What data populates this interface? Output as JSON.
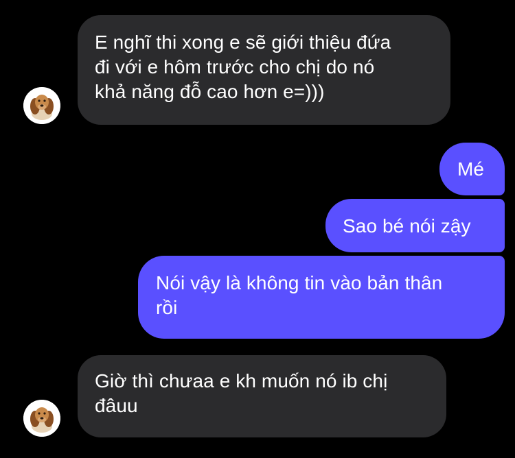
{
  "conversation": {
    "messages": [
      {
        "direction": "incoming",
        "text_lines": [
          "E nghĩ thi xong e sẽ giới thiệu đứa",
          "đi với e hôm trước cho chị do nó",
          "khả năng đỗ cao hơn e=)))"
        ]
      },
      {
        "direction": "outgoing",
        "text_lines": [
          "Mé"
        ]
      },
      {
        "direction": "outgoing",
        "text_lines": [
          "Sao bé nói zậy"
        ]
      },
      {
        "direction": "outgoing",
        "text_lines": [
          "Nói vậy là không tin vào bản thân",
          "rồi"
        ]
      },
      {
        "direction": "incoming",
        "text_lines": [
          "Giờ thì chưaa e kh muốn nó ib chị",
          "đâuu"
        ]
      }
    ],
    "avatar_icon": "dog-avatar-icon",
    "colors": {
      "background": "#000000",
      "incoming_bubble": "#2b2b2d",
      "outgoing_bubble": "#5a50ff",
      "text": "#ffffff"
    }
  }
}
